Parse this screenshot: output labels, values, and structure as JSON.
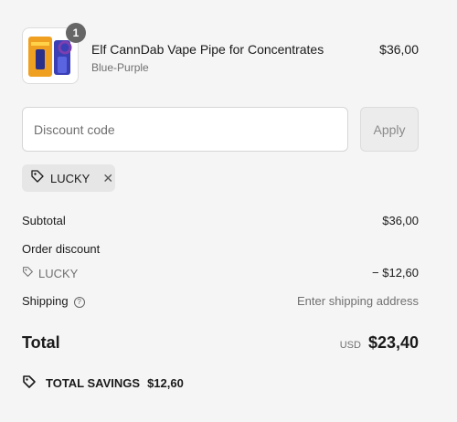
{
  "product": {
    "quantity": "1",
    "title": "Elf CannDab Vape Pipe for Concentrates",
    "variant": "Blue-Purple",
    "price": "$36,00",
    "image": "product-thumbnail"
  },
  "discount": {
    "placeholder": "Discount code",
    "value": "",
    "apply_label": "Apply",
    "applied_code": "LUCKY",
    "remove_icon": "close-icon"
  },
  "summary": {
    "subtotal_label": "Subtotal",
    "subtotal_value": "$36,00",
    "order_discount_label": "Order discount",
    "discount_code": "LUCKY",
    "discount_value": "− $12,60",
    "shipping_label": "Shipping",
    "shipping_value": "Enter shipping address"
  },
  "total": {
    "label": "Total",
    "currency": "USD",
    "amount": "$23,40"
  },
  "savings": {
    "label": "TOTAL SAVINGS",
    "amount": "$12,60"
  }
}
